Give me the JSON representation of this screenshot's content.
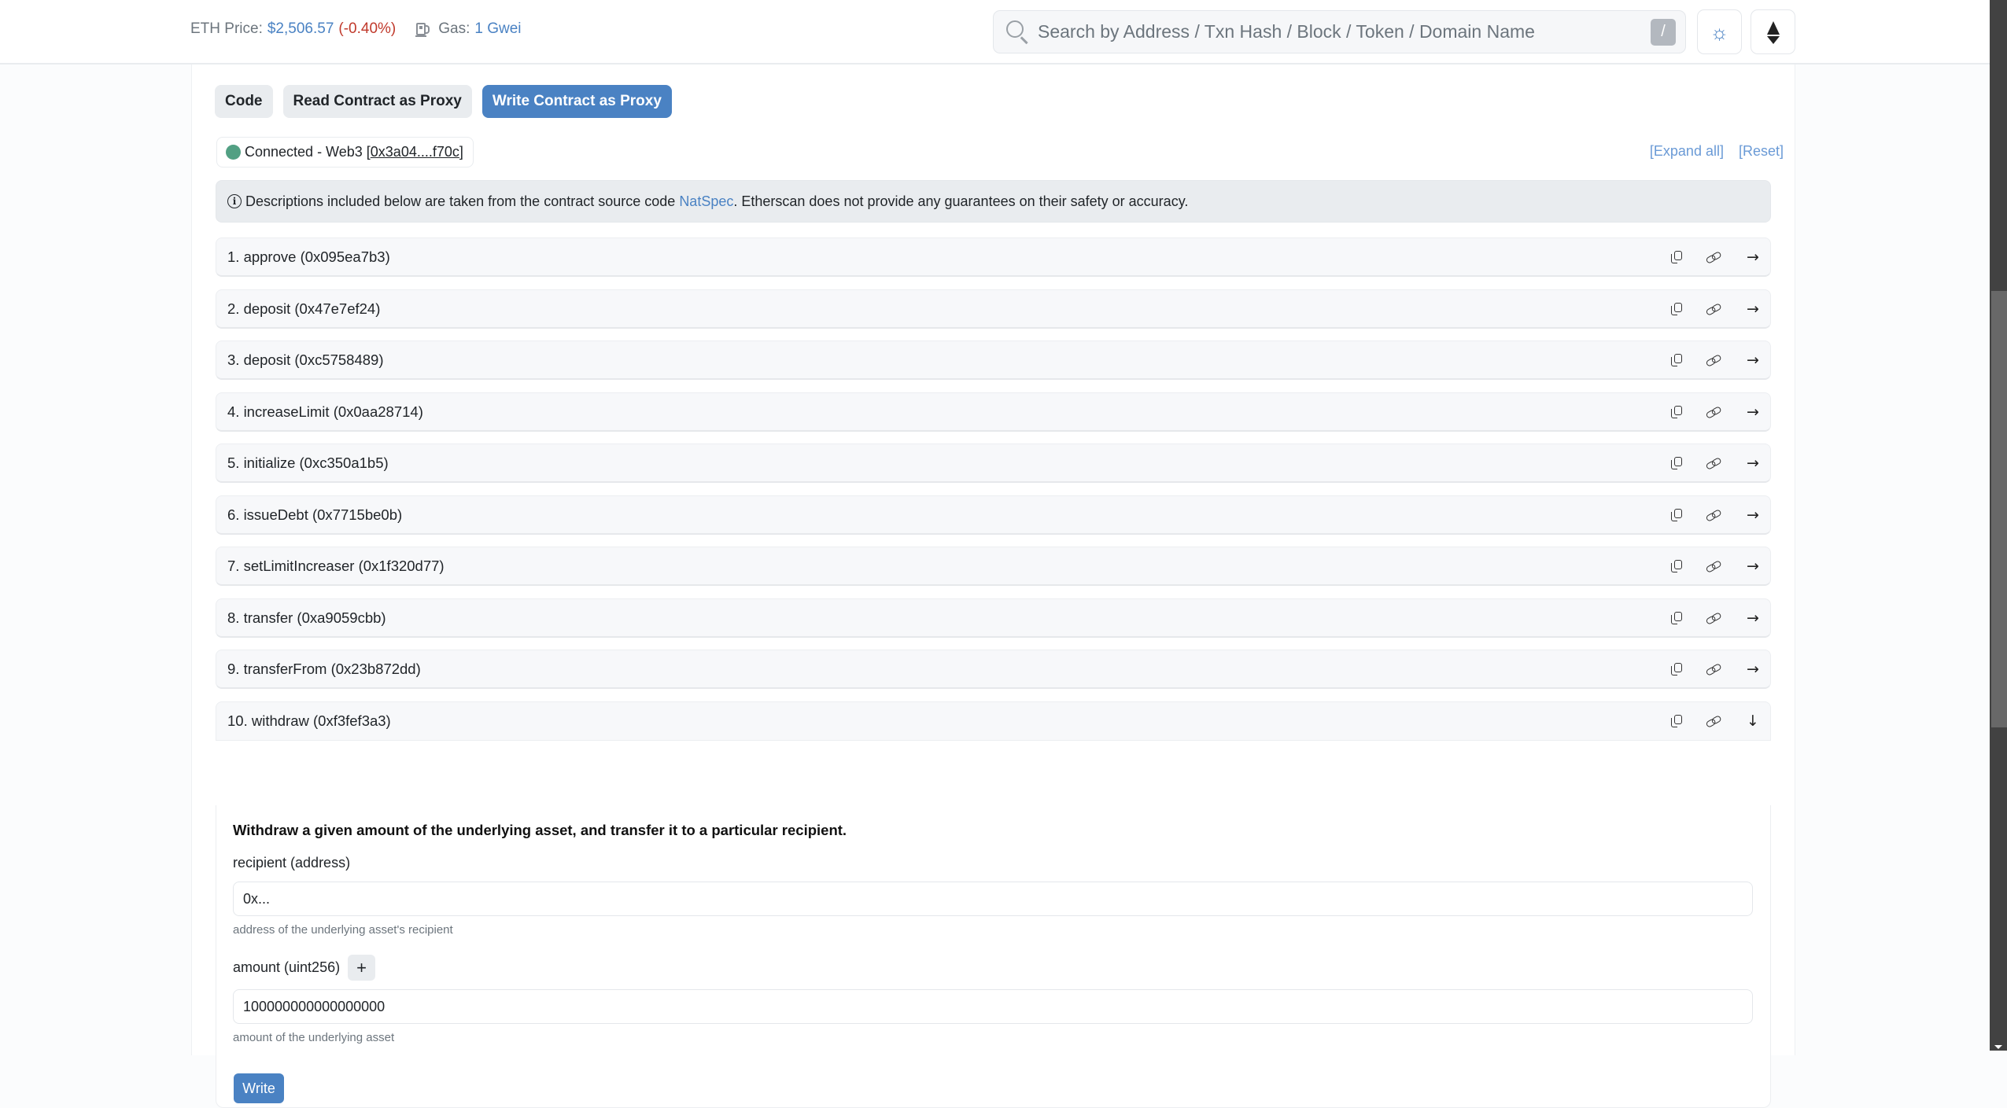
{
  "header": {
    "eth_price_label": "ETH Price:",
    "eth_price_value": "$2,506.57",
    "eth_price_change": "(-0.40%)",
    "gas_label": "Gas:",
    "gas_value": "1 Gwei",
    "search_placeholder": "Search by Address / Txn Hash / Block / Token / Domain Name",
    "search_shortcut": "/",
    "theme_icon": "sun-icon",
    "network_icon": "ethereum-icon"
  },
  "tabs": [
    {
      "label": "Code",
      "active": false
    },
    {
      "label": "Read Contract as Proxy",
      "active": false
    },
    {
      "label": "Write Contract as Proxy",
      "active": true
    }
  ],
  "connection": {
    "status": "Connected - Web3",
    "address": "0x3a04....f70c",
    "status_color": "#52a083"
  },
  "actions": {
    "expand_all": "[Expand all]",
    "reset": "[Reset]"
  },
  "notice": {
    "text_before": "Descriptions included below are taken from the contract source code",
    "link": "NatSpec",
    "text_after": ". Etherscan does not provide any guarantees on their safety or accuracy."
  },
  "functions": [
    {
      "label": "1. approve (0x095ea7b3)",
      "expanded": false
    },
    {
      "label": "2. deposit (0x47e7ef24)",
      "expanded": false
    },
    {
      "label": "3. deposit (0xc5758489)",
      "expanded": false
    },
    {
      "label": "4. increaseLimit (0x0aa28714)",
      "expanded": false
    },
    {
      "label": "5. initialize (0xc350a1b5)",
      "expanded": false
    },
    {
      "label": "6. issueDebt (0x7715be0b)",
      "expanded": false
    },
    {
      "label": "7. setLimitIncreaser (0x1f320d77)",
      "expanded": false
    },
    {
      "label": "8. transfer (0xa9059cbb)",
      "expanded": false
    },
    {
      "label": "9. transferFrom (0x23b872dd)",
      "expanded": false
    },
    {
      "label": "10. withdraw (0xf3fef3a3)",
      "expanded": true
    }
  ],
  "withdraw": {
    "description": "Withdraw a given amount of the underlying asset, and transfer it to a particular recipient.",
    "params": [
      {
        "label": "recipient (address)",
        "placeholder": "0x...",
        "value": "",
        "hint": "address of the underlying asset's recipient"
      },
      {
        "label": "amount (uint256)",
        "placeholder": "",
        "value": "100000000000000000",
        "hint": "amount of the underlying asset",
        "plus_label": "+"
      }
    ],
    "write_label": "Write"
  },
  "colors": {
    "accent": "#4a82c3",
    "negative": "#c0392b",
    "connected": "#52a083"
  }
}
